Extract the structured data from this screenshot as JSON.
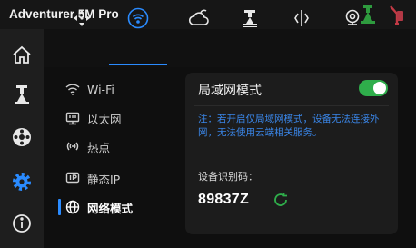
{
  "app": {
    "title": "Adventurer 5M Pro"
  },
  "status_icons": [
    "printer-status-icon",
    "filament-status-icon"
  ],
  "side_nav": [
    "home-icon",
    "print-control-icon",
    "filament-icon",
    "settings-icon",
    "info-icon"
  ],
  "top_tabs": [
    "move-icon",
    "wifi-icon",
    "cloud-icon",
    "printer-icon",
    "sensor-icon",
    "camera-icon"
  ],
  "network_menu": {
    "items": [
      {
        "icon": "wifi-icon",
        "label": "Wi-Fi"
      },
      {
        "icon": "ethernet-icon",
        "label": "以太网"
      },
      {
        "icon": "hotspot-icon",
        "label": "热点"
      },
      {
        "icon": "static-ip-icon",
        "label": "静态IP"
      },
      {
        "icon": "globe-icon",
        "label": "网络模式"
      }
    ]
  },
  "lan_panel": {
    "title": "局域网模式",
    "toggle_on": true,
    "note": "注：若开启仅局域网模式，设备无法连接外网，无法使用云端相关服务。",
    "code_label": "设备识别码：",
    "code_value": "89837Z"
  },
  "colors": {
    "accent": "#2a8bff",
    "toggle_on": "#2fae4b",
    "note_text": "#3a86e8",
    "panel_bg": "#1c1c1c",
    "background": "#0c0c0c"
  }
}
